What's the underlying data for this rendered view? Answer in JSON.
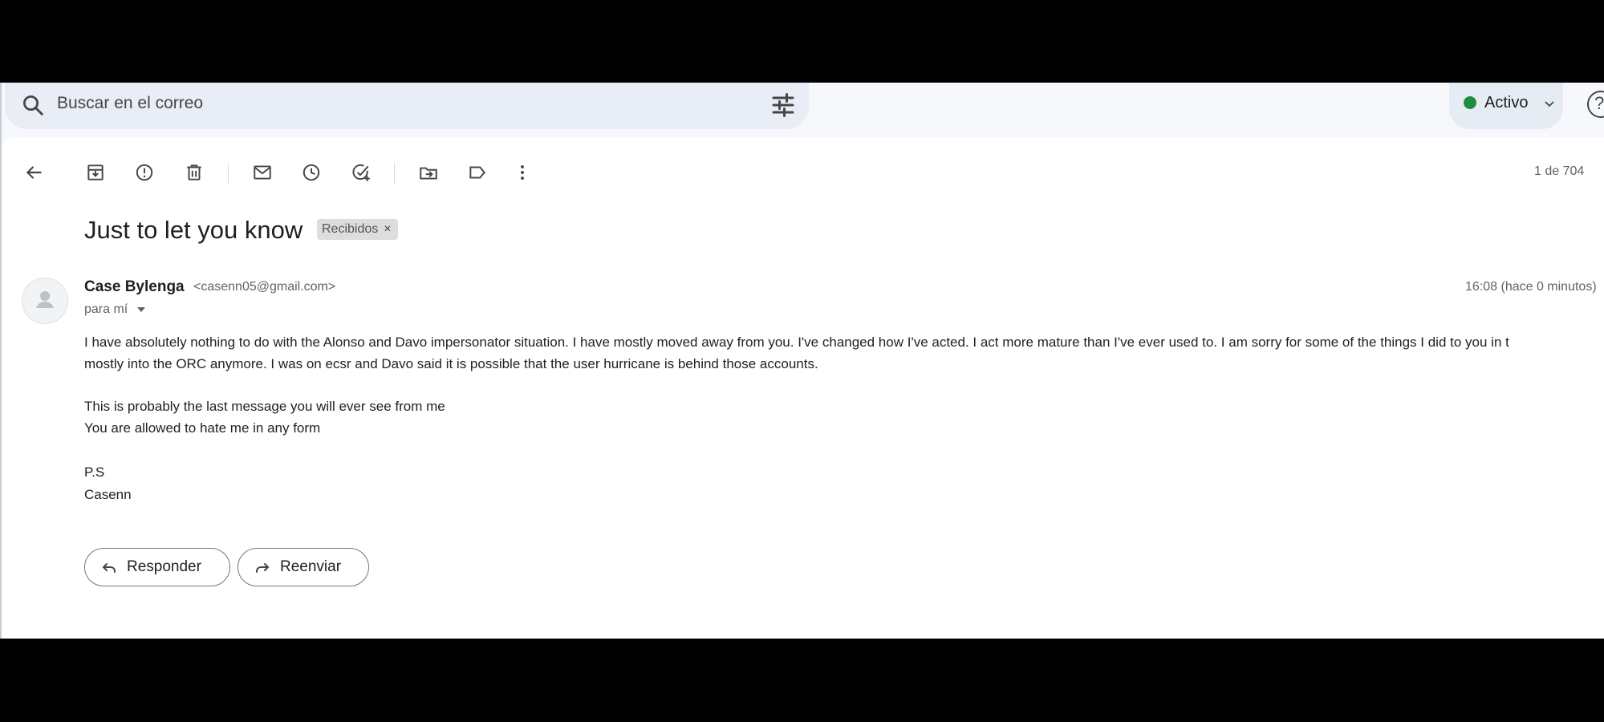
{
  "search": {
    "placeholder": "Buscar en el correo"
  },
  "status": {
    "label": "Activo",
    "color": "#1e8e3e"
  },
  "help": {
    "glyph": "?"
  },
  "toolbar": {
    "icons": [
      "back-arrow-icon",
      "archive-icon",
      "report-spam-icon",
      "delete-icon",
      "mark-unread-icon",
      "snooze-icon",
      "add-task-icon",
      "move-to-icon",
      "label-icon",
      "more-vert-icon"
    ],
    "count": "1 de 704"
  },
  "message": {
    "subject": "Just to let you know",
    "label_chip": "Recibidos",
    "label_chip_close": "×",
    "sender_name": "Case Bylenga",
    "sender_email": "<casenn05@gmail.com>",
    "time": "16:08 (hace 0 minutos)",
    "recipient": "para mí",
    "body_line1": "I have absolutely nothing to do with the Alonso and Davo impersonator situation. I have mostly moved away from you. I've changed how I've acted. I act more mature than I've ever used to. I am sorry for some of the things I did to you in t",
    "body_line2": "mostly into the ORC anymore. I was on ecsr and Davo said it is possible that the user hurricane is behind those accounts.",
    "body_line3": "This is probably the last message you will ever see from me",
    "body_line4": "You are allowed to hate me in any form",
    "body_line5": "P.S",
    "body_line6": "Casenn"
  },
  "actions": {
    "reply": "Responder",
    "forward": "Reenviar"
  }
}
